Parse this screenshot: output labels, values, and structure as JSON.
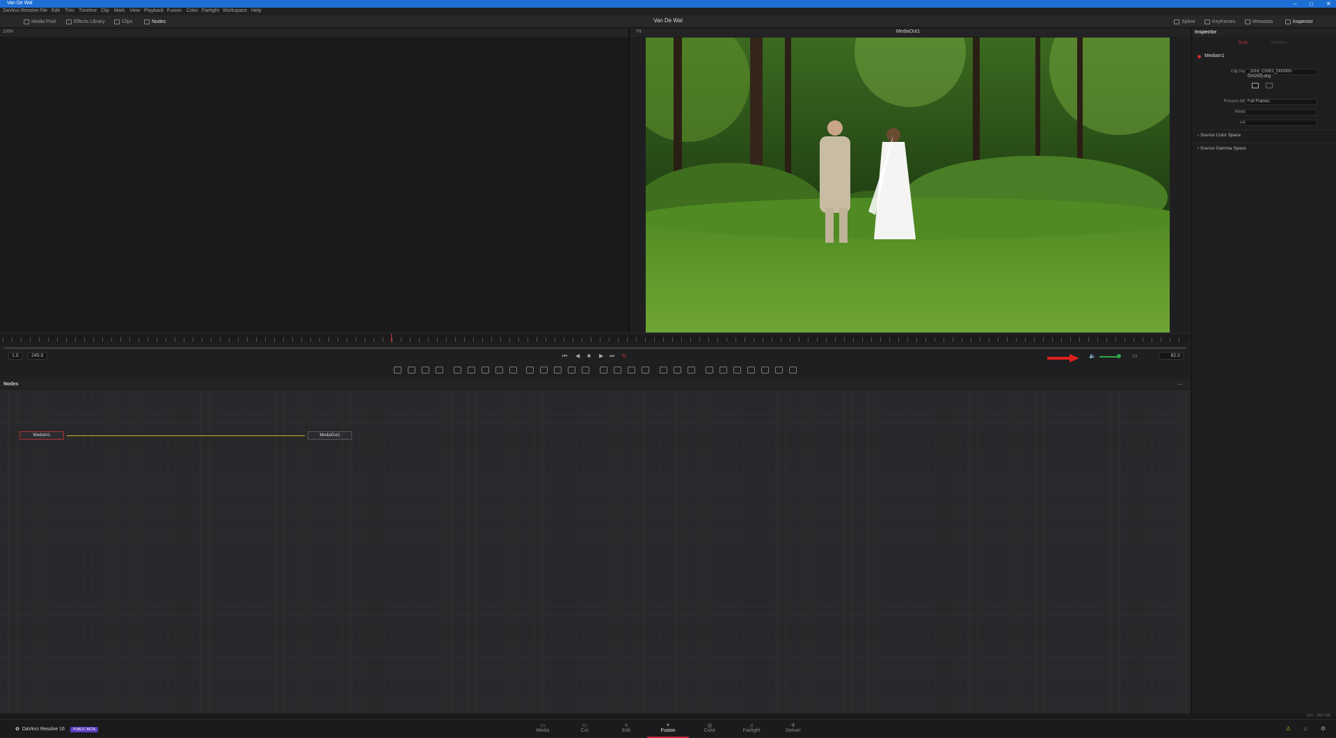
{
  "window": {
    "title": "Van De Wal",
    "controls": [
      "–",
      "□",
      "✕"
    ]
  },
  "menu": [
    "DaVinci Resolve",
    "File",
    "Edit",
    "Trim",
    "Timeline",
    "Clip",
    "Mark",
    "View",
    "Playback",
    "Fusion",
    "Color",
    "Fairlight",
    "Workspace",
    "Help"
  ],
  "toolbar": {
    "media_pool": "Media Pool",
    "effects_library": "Effects Library",
    "clips": "Clips",
    "nodes": "Nodes",
    "project_title": "Van De Wal",
    "spline": "Spline",
    "keyframes": "Keyframes",
    "metadata": "Metadata",
    "inspector": "Inspector"
  },
  "viewer_left": {
    "zoom": "100%"
  },
  "viewer_right": {
    "zoom": "Fit",
    "name": "MediaOut1"
  },
  "transport": {
    "start": "1.0",
    "end": "245.0",
    "current": "82.0"
  },
  "nodes_panel": {
    "title": "Nodes",
    "node_in": "MediaIn1",
    "node_out": "MediaOut1"
  },
  "inspector": {
    "title": "Inspector",
    "tab_tools": "Tools",
    "tab_modifiers": "Modifiers",
    "node_name": "MediaIn1",
    "clip_name_label": "Clip Name",
    "clip_name_value": "_1016_C0051_[000000-000250].dng",
    "process_mode_label": "Process Mode",
    "process_mode_value": "Full Frames",
    "mediaid_label": "MediaID",
    "layer_label": "Layer",
    "section_color": "Source Color Space",
    "section_gamma": "Source Gamma Space"
  },
  "status": {
    "info": "18% - 2507 MB"
  },
  "pages": [
    "Media",
    "Cut",
    "Edit",
    "Fusion",
    "Color",
    "Fairlight",
    "Deliver"
  ],
  "active_page": "Fusion",
  "brand": {
    "name": "DaVinci Resolve 16",
    "badge": "PUBLIC BETA"
  },
  "colors": {
    "accent": "#c8283c",
    "titlebar": "#1e6fd4",
    "connection": "#e0b020",
    "arrow": "#e02020"
  }
}
